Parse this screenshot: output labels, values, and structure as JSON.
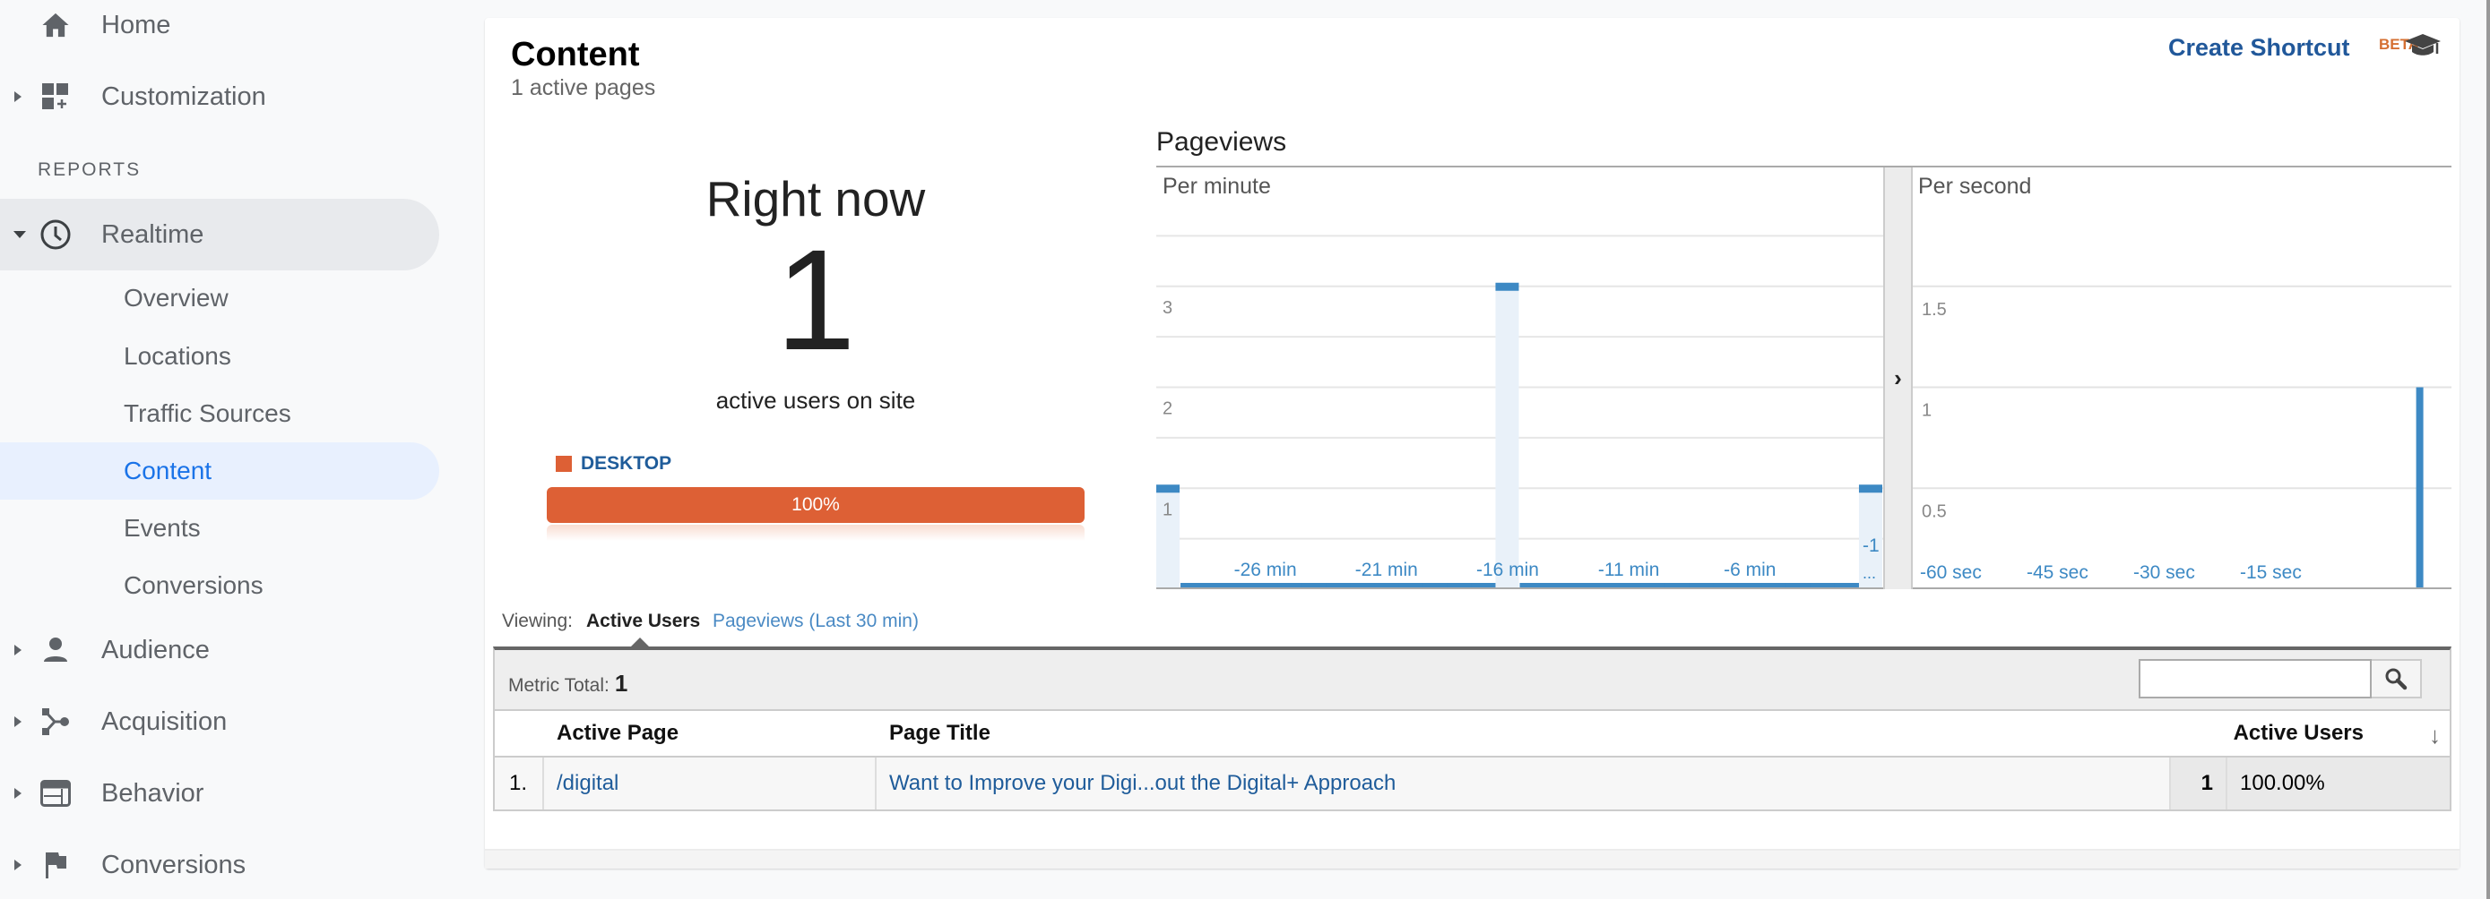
{
  "sidebar": {
    "home": "Home",
    "customization": "Customization",
    "reports_header": "REPORTS",
    "realtime": "Realtime",
    "realtime_children": [
      "Overview",
      "Locations",
      "Traffic Sources",
      "Content",
      "Events",
      "Conversions"
    ],
    "active_child": "Content",
    "audience": "Audience",
    "acquisition": "Acquisition",
    "behavior": "Behavior",
    "conversions": "Conversions"
  },
  "header": {
    "title": "Content",
    "subtitle": "1 active pages",
    "shortcut_label": "Create Shortcut",
    "beta_badge": "BETA",
    "help_icon": "graduation-cap-icon"
  },
  "right_now": {
    "title": "Right now",
    "count": "1",
    "caption": "active users on site",
    "device": "DESKTOP",
    "device_share_label": "100%",
    "device_share": 1.0,
    "device_color": "#dd6035"
  },
  "pageviews": {
    "title": "Pageviews",
    "per_minute_label": "Per minute",
    "per_second_label": "Per second",
    "expand_icon": "chevron-right-icon"
  },
  "chart_data": [
    {
      "type": "bar",
      "title": "Pageviews Per minute",
      "xlabel": "",
      "ylabel": "",
      "categories": [
        "-30",
        "-29",
        "-28",
        "-27",
        "-26",
        "-25",
        "-24",
        "-23",
        "-22",
        "-21",
        "-20",
        "-19",
        "-18",
        "-17",
        "-16",
        "-15",
        "-14",
        "-13",
        "-12",
        "-11",
        "-10",
        "-9",
        "-8",
        "-7",
        "-6",
        "-5",
        "-4",
        "-3",
        "-2",
        "-1"
      ],
      "values": [
        1,
        0,
        0,
        0,
        0,
        0,
        0,
        0,
        0,
        0,
        0,
        0,
        0,
        0,
        3,
        0,
        0,
        0,
        0,
        0,
        0,
        0,
        0,
        0,
        0,
        0,
        0,
        0,
        0,
        1
      ],
      "x_tick_labels": [
        "-26 min",
        "-21 min",
        "-16 min",
        "-11 min",
        "-6 min",
        "-1 ..."
      ],
      "x_tick_indices": [
        4,
        9,
        14,
        19,
        24,
        29
      ],
      "y_tick_labels": [
        "1",
        "2",
        "3"
      ],
      "y_ticks": [
        1,
        2,
        3
      ],
      "gridlines": [
        0.5,
        1,
        1.5,
        2,
        2.5,
        3,
        3.5
      ],
      "ylim": [
        0,
        4
      ],
      "grid": true,
      "color": "#3d89c4"
    },
    {
      "type": "bar",
      "title": "Pageviews Per second",
      "xlabel": "",
      "ylabel": "",
      "x_range": [
        -60,
        0
      ],
      "points": [
        {
          "x": -4,
          "y": 1
        }
      ],
      "x_tick_labels": [
        "-60 sec",
        "-45 sec",
        "-30 sec",
        "-15 sec"
      ],
      "x_ticks": [
        -60,
        -45,
        -30,
        -15
      ],
      "y_tick_labels": [
        "0.5",
        "1",
        "1.5"
      ],
      "y_ticks": [
        0.5,
        1,
        1.5
      ],
      "ylim": [
        0,
        2
      ],
      "grid": true,
      "color": "#3d89c4"
    }
  ],
  "viewing": {
    "label": "Viewing:",
    "tabs": [
      "Active Users",
      "Pageviews (Last 30 min)"
    ],
    "active_tab": "Active Users"
  },
  "table": {
    "metric_total_label": "Metric Total:",
    "metric_total_value": "1",
    "search_value": "",
    "columns": [
      "",
      "Active Page",
      "Page Title",
      "Active Users"
    ],
    "rows": [
      {
        "index": "1.",
        "active_page": "/digital",
        "page_title": "Want to Improve your Digi...out the Digital+ Approach",
        "active_users": "1",
        "percent": "100.00%"
      }
    ]
  }
}
